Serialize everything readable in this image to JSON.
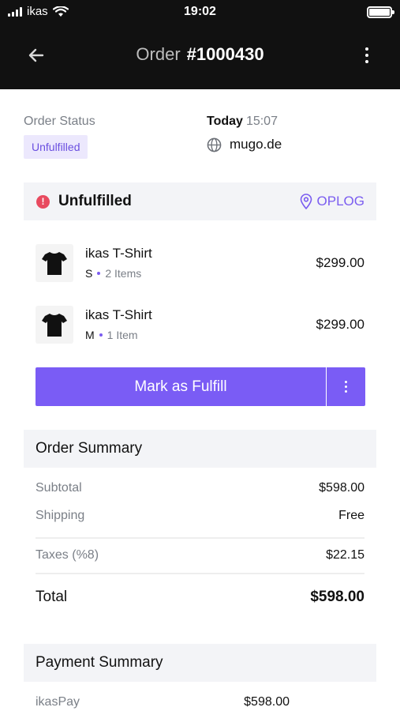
{
  "status_bar": {
    "carrier": "ikas",
    "time": "19:02"
  },
  "header": {
    "title_prefix": "Order",
    "order_number": "#1000430"
  },
  "order_info": {
    "status_label": "Order Status",
    "status_badge": "Unfulfilled",
    "date_day": "Today",
    "date_time": "15:07",
    "domain": "mugo.de"
  },
  "fulfillment": {
    "title": "Unfulfilled",
    "location": "OPLOG",
    "items": [
      {
        "name": "ikas T-Shirt",
        "size": "S",
        "qty": "2 Items",
        "price": "$299.00"
      },
      {
        "name": "ikas T-Shirt",
        "size": "M",
        "qty": "1 Item",
        "price": "$299.00"
      }
    ],
    "button_label": "Mark as Fulfill"
  },
  "order_summary": {
    "title": "Order Summary",
    "subtotal_label": "Subtotal",
    "subtotal_value": "$598.00",
    "shipping_label": "Shipping",
    "shipping_value": "Free",
    "taxes_label": "Taxes (%8)",
    "taxes_value": "$22.15",
    "total_label": "Total",
    "total_value": "$598.00"
  },
  "payment_summary": {
    "title": "Payment Summary",
    "method_label": "ikasPay",
    "method_value": "$598.00"
  },
  "colors": {
    "accent": "#7a5cf5",
    "alert": "#e84a5f",
    "header_bg": "#111111",
    "badge_bg": "#ece8fd"
  }
}
